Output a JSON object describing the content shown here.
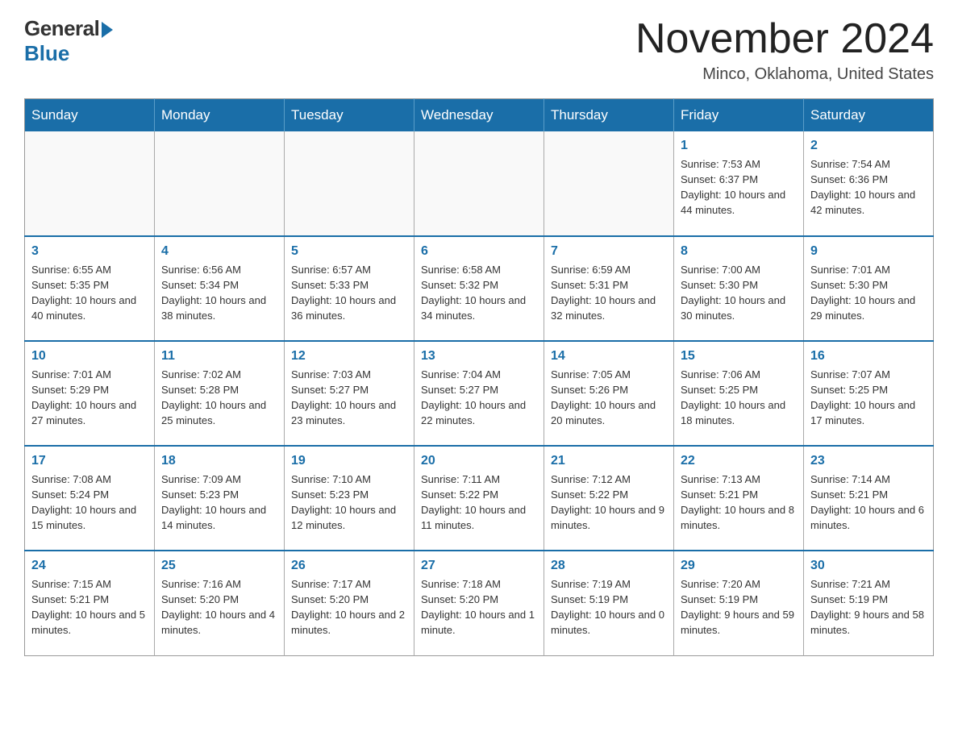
{
  "logo": {
    "text_general": "General",
    "text_blue": "Blue"
  },
  "header": {
    "month": "November 2024",
    "location": "Minco, Oklahoma, United States"
  },
  "weekdays": [
    "Sunday",
    "Monday",
    "Tuesday",
    "Wednesday",
    "Thursday",
    "Friday",
    "Saturday"
  ],
  "weeks": [
    [
      {
        "day": "",
        "info": ""
      },
      {
        "day": "",
        "info": ""
      },
      {
        "day": "",
        "info": ""
      },
      {
        "day": "",
        "info": ""
      },
      {
        "day": "",
        "info": ""
      },
      {
        "day": "1",
        "info": "Sunrise: 7:53 AM\nSunset: 6:37 PM\nDaylight: 10 hours and 44 minutes."
      },
      {
        "day": "2",
        "info": "Sunrise: 7:54 AM\nSunset: 6:36 PM\nDaylight: 10 hours and 42 minutes."
      }
    ],
    [
      {
        "day": "3",
        "info": "Sunrise: 6:55 AM\nSunset: 5:35 PM\nDaylight: 10 hours and 40 minutes."
      },
      {
        "day": "4",
        "info": "Sunrise: 6:56 AM\nSunset: 5:34 PM\nDaylight: 10 hours and 38 minutes."
      },
      {
        "day": "5",
        "info": "Sunrise: 6:57 AM\nSunset: 5:33 PM\nDaylight: 10 hours and 36 minutes."
      },
      {
        "day": "6",
        "info": "Sunrise: 6:58 AM\nSunset: 5:32 PM\nDaylight: 10 hours and 34 minutes."
      },
      {
        "day": "7",
        "info": "Sunrise: 6:59 AM\nSunset: 5:31 PM\nDaylight: 10 hours and 32 minutes."
      },
      {
        "day": "8",
        "info": "Sunrise: 7:00 AM\nSunset: 5:30 PM\nDaylight: 10 hours and 30 minutes."
      },
      {
        "day": "9",
        "info": "Sunrise: 7:01 AM\nSunset: 5:30 PM\nDaylight: 10 hours and 29 minutes."
      }
    ],
    [
      {
        "day": "10",
        "info": "Sunrise: 7:01 AM\nSunset: 5:29 PM\nDaylight: 10 hours and 27 minutes."
      },
      {
        "day": "11",
        "info": "Sunrise: 7:02 AM\nSunset: 5:28 PM\nDaylight: 10 hours and 25 minutes."
      },
      {
        "day": "12",
        "info": "Sunrise: 7:03 AM\nSunset: 5:27 PM\nDaylight: 10 hours and 23 minutes."
      },
      {
        "day": "13",
        "info": "Sunrise: 7:04 AM\nSunset: 5:27 PM\nDaylight: 10 hours and 22 minutes."
      },
      {
        "day": "14",
        "info": "Sunrise: 7:05 AM\nSunset: 5:26 PM\nDaylight: 10 hours and 20 minutes."
      },
      {
        "day": "15",
        "info": "Sunrise: 7:06 AM\nSunset: 5:25 PM\nDaylight: 10 hours and 18 minutes."
      },
      {
        "day": "16",
        "info": "Sunrise: 7:07 AM\nSunset: 5:25 PM\nDaylight: 10 hours and 17 minutes."
      }
    ],
    [
      {
        "day": "17",
        "info": "Sunrise: 7:08 AM\nSunset: 5:24 PM\nDaylight: 10 hours and 15 minutes."
      },
      {
        "day": "18",
        "info": "Sunrise: 7:09 AM\nSunset: 5:23 PM\nDaylight: 10 hours and 14 minutes."
      },
      {
        "day": "19",
        "info": "Sunrise: 7:10 AM\nSunset: 5:23 PM\nDaylight: 10 hours and 12 minutes."
      },
      {
        "day": "20",
        "info": "Sunrise: 7:11 AM\nSunset: 5:22 PM\nDaylight: 10 hours and 11 minutes."
      },
      {
        "day": "21",
        "info": "Sunrise: 7:12 AM\nSunset: 5:22 PM\nDaylight: 10 hours and 9 minutes."
      },
      {
        "day": "22",
        "info": "Sunrise: 7:13 AM\nSunset: 5:21 PM\nDaylight: 10 hours and 8 minutes."
      },
      {
        "day": "23",
        "info": "Sunrise: 7:14 AM\nSunset: 5:21 PM\nDaylight: 10 hours and 6 minutes."
      }
    ],
    [
      {
        "day": "24",
        "info": "Sunrise: 7:15 AM\nSunset: 5:21 PM\nDaylight: 10 hours and 5 minutes."
      },
      {
        "day": "25",
        "info": "Sunrise: 7:16 AM\nSunset: 5:20 PM\nDaylight: 10 hours and 4 minutes."
      },
      {
        "day": "26",
        "info": "Sunrise: 7:17 AM\nSunset: 5:20 PM\nDaylight: 10 hours and 2 minutes."
      },
      {
        "day": "27",
        "info": "Sunrise: 7:18 AM\nSunset: 5:20 PM\nDaylight: 10 hours and 1 minute."
      },
      {
        "day": "28",
        "info": "Sunrise: 7:19 AM\nSunset: 5:19 PM\nDaylight: 10 hours and 0 minutes."
      },
      {
        "day": "29",
        "info": "Sunrise: 7:20 AM\nSunset: 5:19 PM\nDaylight: 9 hours and 59 minutes."
      },
      {
        "day": "30",
        "info": "Sunrise: 7:21 AM\nSunset: 5:19 PM\nDaylight: 9 hours and 58 minutes."
      }
    ]
  ]
}
